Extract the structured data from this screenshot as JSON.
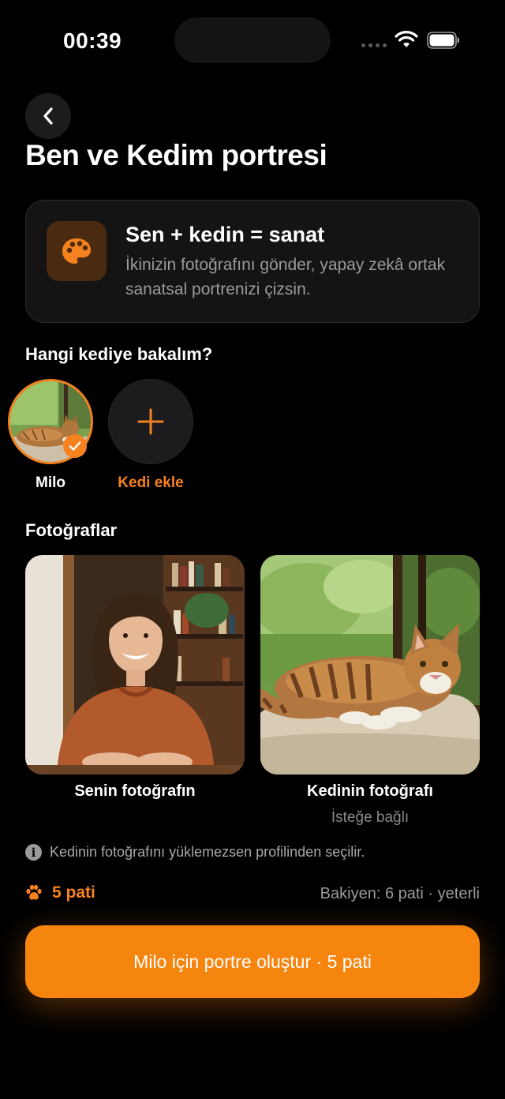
{
  "status_bar": {
    "time": "00:39"
  },
  "header": {
    "title": "Ben ve Kedim portresi"
  },
  "info_card": {
    "title": "Sen + kedin = sanat",
    "description": "İkinizin fotoğrafını gönder, yapay zekâ ortak sanatsal portrenizi çizsin.",
    "icon": "palette-icon"
  },
  "cat_section": {
    "label": "Hangi kediye bakalım?",
    "cats": [
      {
        "name": "Milo",
        "selected": true
      }
    ],
    "add_label": "Kedi ekle"
  },
  "photos": {
    "label": "Fotoğraflar",
    "user_caption": "Senin fotoğrafın",
    "cat_caption": "Kedinin fotoğrafı",
    "cat_optional": "İsteğe bağlı"
  },
  "hint": "Kedinin fotoğrafını yüklemezsen profilinden seçilir.",
  "cost": {
    "label": "5 pati",
    "icon": "paw-icon"
  },
  "balance": "Bakiyen: 6 pati · yeterli",
  "cta_label": "Milo için portre oluştur · 5 pati",
  "colors": {
    "accent": "#f5821f",
    "background": "#000000",
    "card": "#141414"
  }
}
